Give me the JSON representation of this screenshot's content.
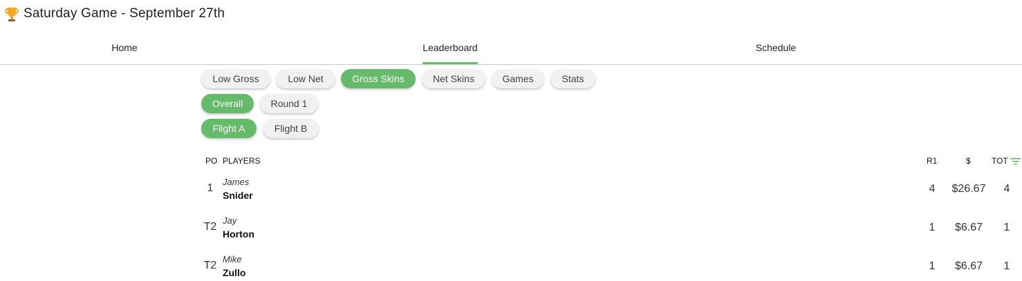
{
  "header": {
    "title": "Saturday Game - September 27th",
    "icon": "trophy-icon"
  },
  "tabs": [
    {
      "label": "Home"
    },
    {
      "label": "Leaderboard",
      "active": true
    },
    {
      "label": "Schedule"
    }
  ],
  "chips": {
    "types": [
      {
        "label": "Low Gross"
      },
      {
        "label": "Low Net"
      },
      {
        "label": "Gross Skins",
        "selected": true
      },
      {
        "label": "Net Skins"
      },
      {
        "label": "Games"
      },
      {
        "label": "Stats"
      }
    ],
    "rounds": [
      {
        "label": "Overall",
        "selected": true
      },
      {
        "label": "Round 1"
      }
    ],
    "flights": [
      {
        "label": "Flight A",
        "selected": true
      },
      {
        "label": "Flight B"
      }
    ]
  },
  "table": {
    "headers": {
      "pos": "PO",
      "players": "PLAYERS",
      "r1": "R1",
      "money": "$",
      "tot": "TOT"
    },
    "rows": [
      {
        "pos": "1",
        "first": "James",
        "last": "Snider",
        "r1": "4",
        "money": "$26.67",
        "tot": "4"
      },
      {
        "pos": "T2",
        "first": "Jay",
        "last": "Horton",
        "r1": "1",
        "money": "$6.67",
        "tot": "1"
      },
      {
        "pos": "T2",
        "first": "Mike",
        "last": "Zullo",
        "r1": "1",
        "money": "$6.67",
        "tot": "1"
      }
    ]
  },
  "colors": {
    "accent": "#66bb6a",
    "chip_bg": "#f1f1f1",
    "divider": "#cfcfcf"
  }
}
